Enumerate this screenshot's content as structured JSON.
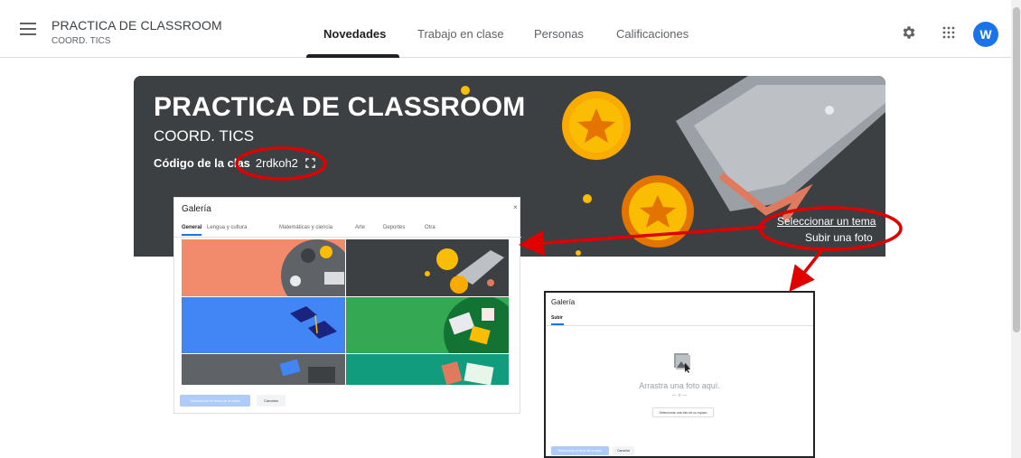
{
  "header": {
    "course_title": "PRACTICA DE CLASSROOM",
    "course_subtitle": "COORD. TICS",
    "tabs": [
      {
        "label": "Novedades",
        "active": true
      },
      {
        "label": "Trabajo en clase",
        "active": false
      },
      {
        "label": "Personas",
        "active": false
      },
      {
        "label": "Calificaciones",
        "active": false
      }
    ],
    "avatar_letter": "W",
    "icons": {
      "menu": "hamburger-menu-icon",
      "settings": "gear-icon",
      "apps": "apps-grid-icon"
    }
  },
  "banner": {
    "title": "PRACTICA DE CLASSROOM",
    "subtitle": "COORD. TICS",
    "code_label": "Código de la clas",
    "code_value": "2rdkoh2",
    "select_theme": "Seleccionar un tema",
    "upload_photo": "Subir una foto"
  },
  "gallery_themes": {
    "title": "Galería",
    "close": "×",
    "tabs": [
      "General",
      "Lengua y cultura",
      "Matemáticas y ciencia",
      "Arte",
      "Deportes",
      "Otra"
    ],
    "select_button": "Seleccionar el tema de la clase",
    "cancel_button": "Cancelar"
  },
  "gallery_upload": {
    "title": "Galería",
    "tab": "Subir",
    "drag_text": "Arrastra una foto aquí.",
    "or_text": "— o —",
    "pick_button": "Seleccionar una foto de su equipo",
    "select_button": "Seleccionar el tema de la clase",
    "cancel_button": "Cancelar"
  },
  "colors": {
    "accent": "#1a73e8",
    "banner_bg": "#3c4043",
    "annotation_red": "#e00000",
    "thumb_orange": "#f28b6b",
    "thumb_dark": "#3c4043",
    "thumb_blue": "#4285f4",
    "thumb_green": "#34a853",
    "thumb_slate": "#5f6368",
    "thumb_teal": "#129c7e"
  }
}
